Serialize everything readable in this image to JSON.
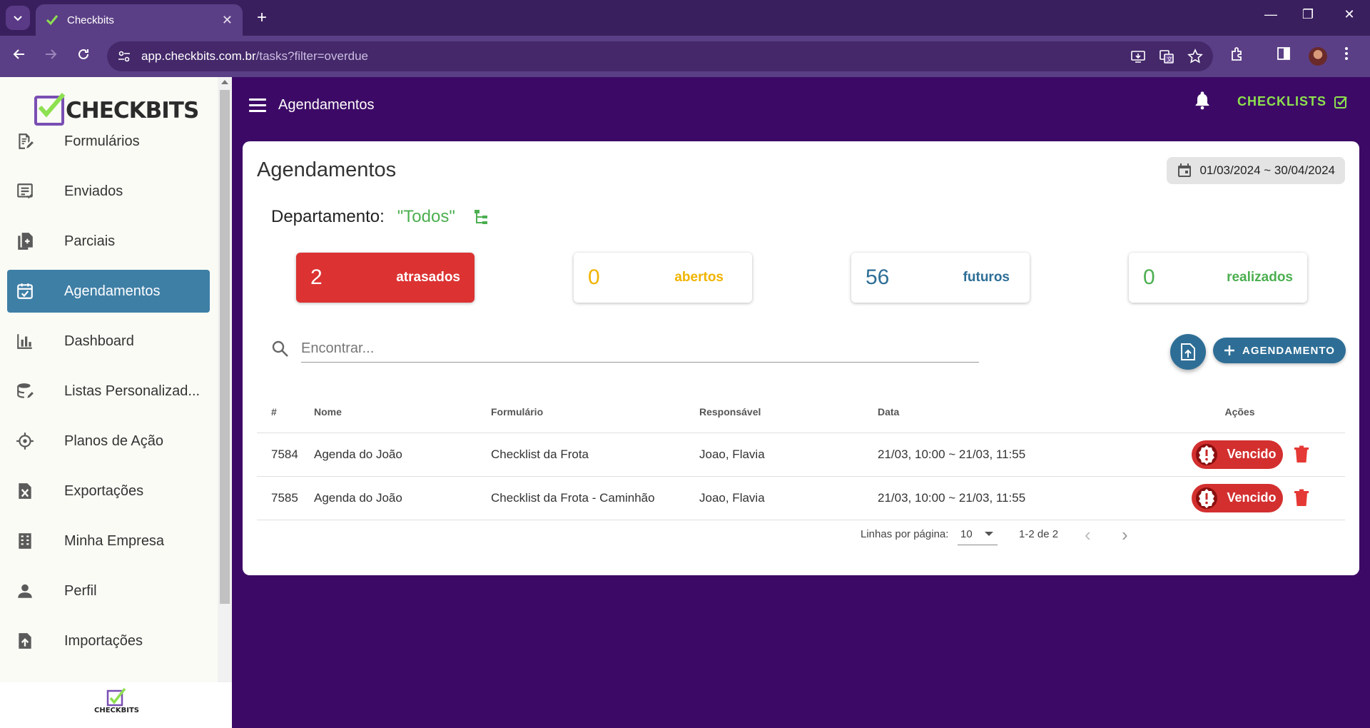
{
  "browser": {
    "tab_title": "Checkbits",
    "url_host": "app.checkbits.com.br",
    "url_path": "/tasks?filter=overdue"
  },
  "sidebar": {
    "logo_text": "CHECKBITS",
    "items": [
      {
        "label": "Formulários",
        "icon": "form-edit-icon"
      },
      {
        "label": "Enviados",
        "icon": "sent-list-icon"
      },
      {
        "label": "Parciais",
        "icon": "partial-docs-icon"
      },
      {
        "label": "Agendamentos",
        "icon": "calendar-check-icon",
        "active": true
      },
      {
        "label": "Dashboard",
        "icon": "bar-chart-icon"
      },
      {
        "label": "Listas Personalizad...",
        "icon": "database-icon"
      },
      {
        "label": "Planos de Ação",
        "icon": "crosshair-icon"
      },
      {
        "label": "Exportações",
        "icon": "excel-file-icon"
      },
      {
        "label": "Minha Empresa",
        "icon": "building-icon"
      },
      {
        "label": "Perfil",
        "icon": "person-icon"
      },
      {
        "label": "Importações",
        "icon": "file-upload-icon"
      }
    ],
    "footer_logo_text": "CHECKBITS"
  },
  "header": {
    "title": "Agendamentos",
    "checklists_label": "CHECKLISTS"
  },
  "main": {
    "title": "Agendamentos",
    "date_range": "01/03/2024 ~ 30/04/2024",
    "department_label": "Departamento:",
    "department_value": "\"Todos\"",
    "stats": [
      {
        "value": "2",
        "label": "atrasados",
        "color": "#dc3232"
      },
      {
        "value": "0",
        "label": "abertos",
        "color": "#f0b400"
      },
      {
        "value": "56",
        "label": "futuros",
        "color": "#2e6e96"
      },
      {
        "value": "0",
        "label": "realizados",
        "color": "#4caf50"
      }
    ],
    "search_placeholder": "Encontrar...",
    "add_button_label": "AGENDAMENTO",
    "table": {
      "headers": [
        "#",
        "Nome",
        "Formulário",
        "Responsável",
        "Data",
        "Ações"
      ],
      "rows": [
        {
          "id": "7584",
          "nome": "Agenda do João",
          "formulario": "Checklist da Frota",
          "responsavel": "Joao, Flavia",
          "data": "21/03, 10:00 ~ 21/03, 11:55",
          "status": "Vencido"
        },
        {
          "id": "7585",
          "nome": "Agenda do João",
          "formulario": "Checklist da Frota - Caminhão",
          "responsavel": "Joao, Flavia",
          "data": "21/03, 10:00 ~ 21/03, 11:55",
          "status": "Vencido"
        }
      ]
    },
    "pagination": {
      "rows_per_page_label": "Linhas por página:",
      "rows_per_page_value": "10",
      "range": "1-2 de 2"
    }
  },
  "colors": {
    "brand_purple": "#3c0a66",
    "accent_blue": "#3e7fa6",
    "green": "#8de04f",
    "danger": "#d32f2f"
  }
}
